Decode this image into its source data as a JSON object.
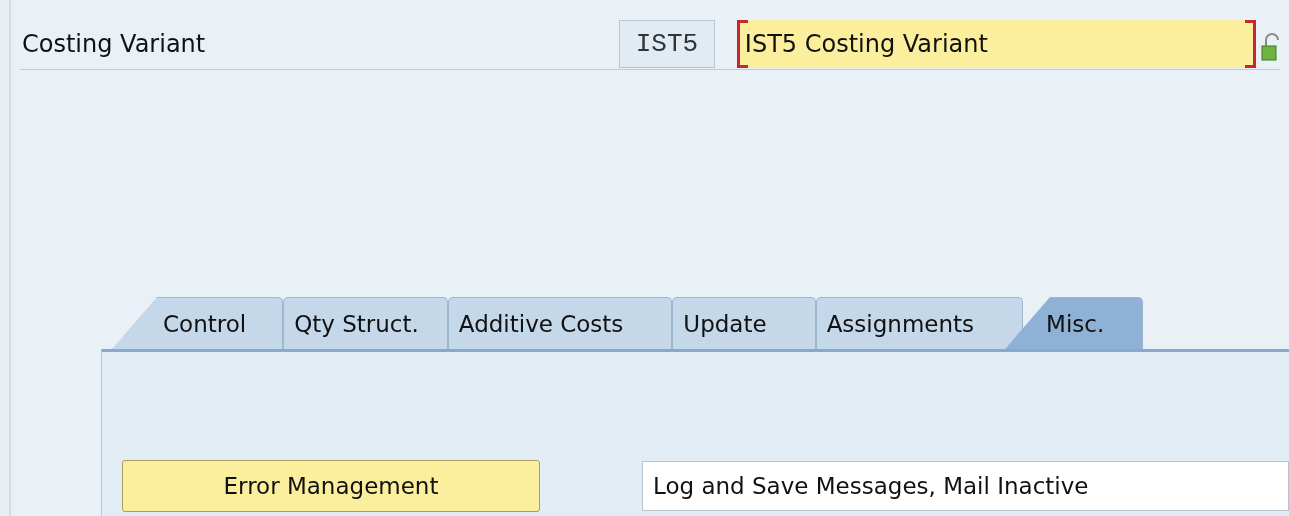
{
  "header": {
    "label": "Costing Variant",
    "code": "IST5",
    "description": "IST5 Costing Variant"
  },
  "tabs": [
    {
      "label": "Control",
      "selected": false
    },
    {
      "label": "Qty Struct.",
      "selected": false
    },
    {
      "label": "Additive Costs",
      "selected": false
    },
    {
      "label": "Update",
      "selected": false
    },
    {
      "label": "Assignments",
      "selected": false
    },
    {
      "label": "Misc.",
      "selected": true
    }
  ],
  "panel": {
    "button": "Error Management",
    "value": "Log and Save Messages, Mail Inactive"
  }
}
